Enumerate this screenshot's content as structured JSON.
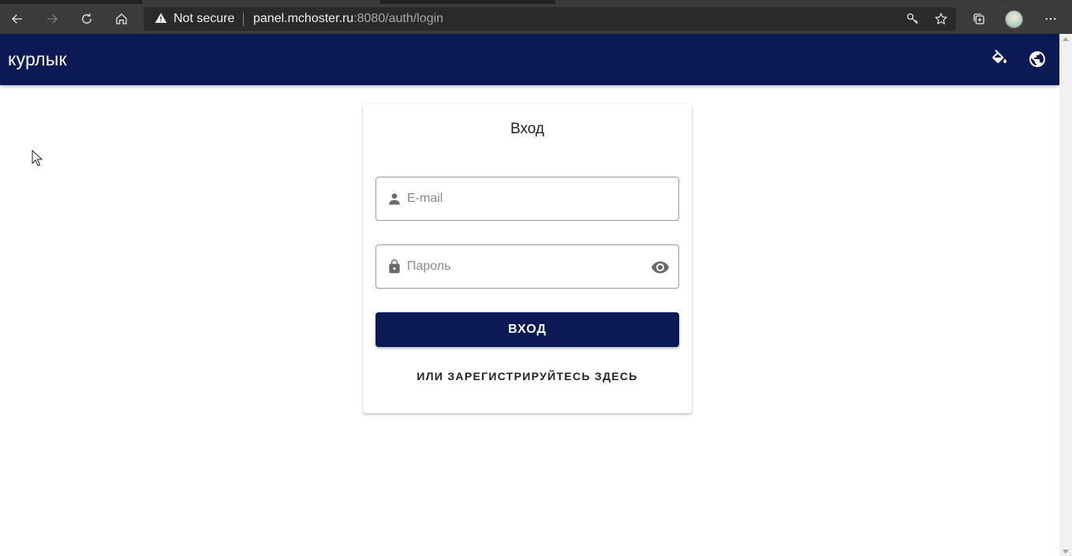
{
  "browser": {
    "security_label": "Not secure",
    "url_host": "panel.mchoster.ru",
    "url_path": ":8080/auth/login",
    "icons": [
      "back-icon",
      "forward-icon",
      "refresh-icon",
      "home-icon",
      "warning-icon",
      "key-icon",
      "favorite-star-icon",
      "collections-icon",
      "profile-avatar",
      "more-menu-icon"
    ]
  },
  "appbar": {
    "brand": "курлык",
    "background": "#0b1a55",
    "icons": [
      "paint-bucket-icon",
      "globe-icon"
    ]
  },
  "login": {
    "title": "Вход",
    "email_placeholder": "E-mail",
    "password_placeholder": "Пароль",
    "submit_label": "ВХОД",
    "register_label": "ИЛИ ЗАРЕГИСТРИРУЙТЕСЬ ЗДЕСЬ",
    "accent": "#0b1a55"
  }
}
